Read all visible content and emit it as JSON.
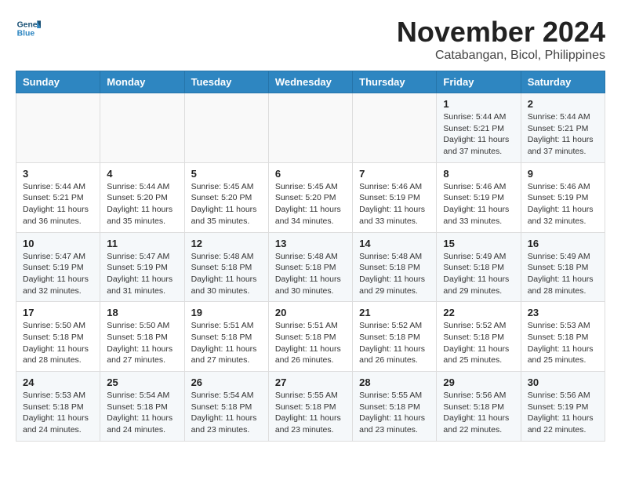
{
  "logo": {
    "line1": "General",
    "line2": "Blue"
  },
  "title": {
    "month": "November 2024",
    "location": "Catabangan, Bicol, Philippines"
  },
  "headers": [
    "Sunday",
    "Monday",
    "Tuesday",
    "Wednesday",
    "Thursday",
    "Friday",
    "Saturday"
  ],
  "weeks": [
    [
      {
        "day": "",
        "info": ""
      },
      {
        "day": "",
        "info": ""
      },
      {
        "day": "",
        "info": ""
      },
      {
        "day": "",
        "info": ""
      },
      {
        "day": "",
        "info": ""
      },
      {
        "day": "1",
        "info": "Sunrise: 5:44 AM\nSunset: 5:21 PM\nDaylight: 11 hours and 37 minutes."
      },
      {
        "day": "2",
        "info": "Sunrise: 5:44 AM\nSunset: 5:21 PM\nDaylight: 11 hours and 37 minutes."
      }
    ],
    [
      {
        "day": "3",
        "info": "Sunrise: 5:44 AM\nSunset: 5:21 PM\nDaylight: 11 hours and 36 minutes."
      },
      {
        "day": "4",
        "info": "Sunrise: 5:44 AM\nSunset: 5:20 PM\nDaylight: 11 hours and 35 minutes."
      },
      {
        "day": "5",
        "info": "Sunrise: 5:45 AM\nSunset: 5:20 PM\nDaylight: 11 hours and 35 minutes."
      },
      {
        "day": "6",
        "info": "Sunrise: 5:45 AM\nSunset: 5:20 PM\nDaylight: 11 hours and 34 minutes."
      },
      {
        "day": "7",
        "info": "Sunrise: 5:46 AM\nSunset: 5:19 PM\nDaylight: 11 hours and 33 minutes."
      },
      {
        "day": "8",
        "info": "Sunrise: 5:46 AM\nSunset: 5:19 PM\nDaylight: 11 hours and 33 minutes."
      },
      {
        "day": "9",
        "info": "Sunrise: 5:46 AM\nSunset: 5:19 PM\nDaylight: 11 hours and 32 minutes."
      }
    ],
    [
      {
        "day": "10",
        "info": "Sunrise: 5:47 AM\nSunset: 5:19 PM\nDaylight: 11 hours and 32 minutes."
      },
      {
        "day": "11",
        "info": "Sunrise: 5:47 AM\nSunset: 5:19 PM\nDaylight: 11 hours and 31 minutes."
      },
      {
        "day": "12",
        "info": "Sunrise: 5:48 AM\nSunset: 5:18 PM\nDaylight: 11 hours and 30 minutes."
      },
      {
        "day": "13",
        "info": "Sunrise: 5:48 AM\nSunset: 5:18 PM\nDaylight: 11 hours and 30 minutes."
      },
      {
        "day": "14",
        "info": "Sunrise: 5:48 AM\nSunset: 5:18 PM\nDaylight: 11 hours and 29 minutes."
      },
      {
        "day": "15",
        "info": "Sunrise: 5:49 AM\nSunset: 5:18 PM\nDaylight: 11 hours and 29 minutes."
      },
      {
        "day": "16",
        "info": "Sunrise: 5:49 AM\nSunset: 5:18 PM\nDaylight: 11 hours and 28 minutes."
      }
    ],
    [
      {
        "day": "17",
        "info": "Sunrise: 5:50 AM\nSunset: 5:18 PM\nDaylight: 11 hours and 28 minutes."
      },
      {
        "day": "18",
        "info": "Sunrise: 5:50 AM\nSunset: 5:18 PM\nDaylight: 11 hours and 27 minutes."
      },
      {
        "day": "19",
        "info": "Sunrise: 5:51 AM\nSunset: 5:18 PM\nDaylight: 11 hours and 27 minutes."
      },
      {
        "day": "20",
        "info": "Sunrise: 5:51 AM\nSunset: 5:18 PM\nDaylight: 11 hours and 26 minutes."
      },
      {
        "day": "21",
        "info": "Sunrise: 5:52 AM\nSunset: 5:18 PM\nDaylight: 11 hours and 26 minutes."
      },
      {
        "day": "22",
        "info": "Sunrise: 5:52 AM\nSunset: 5:18 PM\nDaylight: 11 hours and 25 minutes."
      },
      {
        "day": "23",
        "info": "Sunrise: 5:53 AM\nSunset: 5:18 PM\nDaylight: 11 hours and 25 minutes."
      }
    ],
    [
      {
        "day": "24",
        "info": "Sunrise: 5:53 AM\nSunset: 5:18 PM\nDaylight: 11 hours and 24 minutes."
      },
      {
        "day": "25",
        "info": "Sunrise: 5:54 AM\nSunset: 5:18 PM\nDaylight: 11 hours and 24 minutes."
      },
      {
        "day": "26",
        "info": "Sunrise: 5:54 AM\nSunset: 5:18 PM\nDaylight: 11 hours and 23 minutes."
      },
      {
        "day": "27",
        "info": "Sunrise: 5:55 AM\nSunset: 5:18 PM\nDaylight: 11 hours and 23 minutes."
      },
      {
        "day": "28",
        "info": "Sunrise: 5:55 AM\nSunset: 5:18 PM\nDaylight: 11 hours and 23 minutes."
      },
      {
        "day": "29",
        "info": "Sunrise: 5:56 AM\nSunset: 5:18 PM\nDaylight: 11 hours and 22 minutes."
      },
      {
        "day": "30",
        "info": "Sunrise: 5:56 AM\nSunset: 5:19 PM\nDaylight: 11 hours and 22 minutes."
      }
    ]
  ]
}
